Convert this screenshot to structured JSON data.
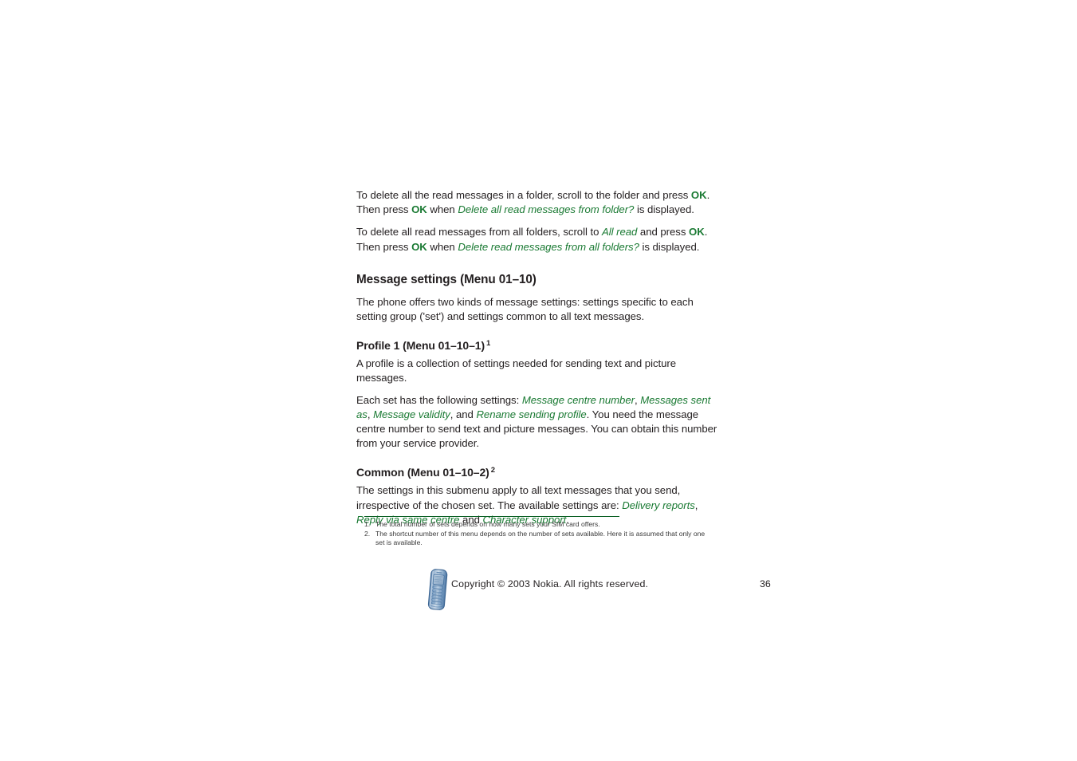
{
  "document": {
    "page_number": "36",
    "copyright": "Copyright © 2003 Nokia. All rights reserved.",
    "accent_green": "#1a7a33",
    "rule_green": "#0a6023",
    "text_color": "#231f20"
  },
  "paragraphs": {
    "p1": {
      "seg1": "To delete all the read messages in a folder, scroll to the folder and press ",
      "key1": "OK",
      "seg2": ". Then press ",
      "key2": "OK",
      "seg3": " when ",
      "term1": "Delete all read messages from folder?",
      "seg4": " is displayed."
    },
    "p2": {
      "seg1": "To delete all read messages from all folders, scroll to ",
      "term1": "All read",
      "seg2": " and press ",
      "key1": "OK",
      "seg3": ". Then press ",
      "key2": "OK",
      "seg4": " when ",
      "term2": "Delete read messages from all folders?",
      "seg5": " is displayed."
    }
  },
  "section": {
    "heading": "Message settings (Menu 01–10)",
    "intro": "The phone offers two kinds of message settings: settings specific to each setting group ('set') and settings common to all text messages."
  },
  "profile": {
    "heading": "Profile 1 (Menu 01–10–1)",
    "heading_footnote": "1",
    "para1": "A profile is a collection of settings needed for sending text and picture messages.",
    "para2": {
      "seg1": "Each set has the following settings: ",
      "term1": "Message centre number",
      "seg2": ", ",
      "term2": "Messages sent as",
      "seg3": ", ",
      "term3": "Message validity",
      "seg4": ", and ",
      "term4": "Rename sending profile",
      "seg5": ". You need the message centre number to send text and picture messages. You can obtain this number from your service provider."
    }
  },
  "common": {
    "heading": "Common (Menu 01–10–2)",
    "heading_footnote": "2",
    "para": {
      "seg1": "The settings in this submenu apply to all text messages that you send, irrespective of the chosen set. The available settings are: ",
      "term1": "Delivery reports",
      "seg2": ", ",
      "term2": "Reply via same centre",
      "seg3": " and ",
      "term3": "Character support",
      "seg4": "."
    }
  },
  "footnotes": [
    {
      "number": "1.",
      "text": "The total number of sets depends on how many sets your SIM card offers."
    },
    {
      "number": "2.",
      "text": "The shortcut number of this menu depends on the number of sets available. Here it is assumed that only one set is available."
    }
  ],
  "icons": {
    "phone": "nokia-phone-icon"
  }
}
